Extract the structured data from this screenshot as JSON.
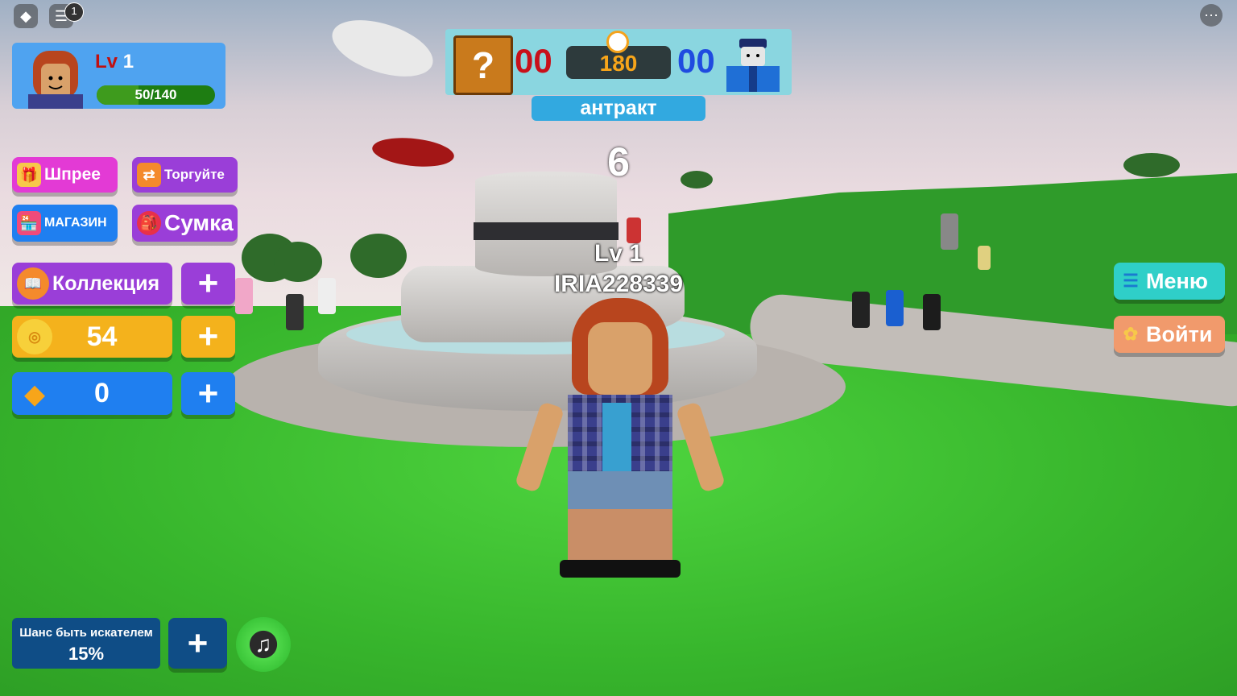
{
  "topbar": {
    "notifications_count": "1"
  },
  "player": {
    "level_prefix": "Lv",
    "level_value": "1",
    "xp_text": "50/140",
    "xp_progress": 0.357
  },
  "left_buttons": {
    "spree_label": "Шпрее",
    "trade_label": "Торгуйте",
    "shop_label": "МАГАЗИН",
    "bag_label": "Сумка",
    "collection_label": "Коллекция",
    "coins_value": "54",
    "gems_value": "0",
    "plus_symbol": "+"
  },
  "match": {
    "red_score": "00",
    "timer": "180",
    "blue_score": "00",
    "status": "антракт",
    "countdown": "6"
  },
  "character_tag": {
    "level": "Lv 1",
    "username": "IRIA228339"
  },
  "right_buttons": {
    "menu_label": "Меню",
    "login_label": "Войти"
  },
  "bottom": {
    "seeker_chance_label": "Шанс быть искателем",
    "seeker_chance_value": "15%"
  },
  "colors": {
    "level_panel": "#4fa3f0",
    "pink_button": "#e33ad5",
    "purple_button": "#9a3ed8",
    "coin_button": "#f4b21c",
    "gem_button": "#1f7ff0",
    "menu_button": "#2fcfc8",
    "login_button": "#f19a6c"
  }
}
